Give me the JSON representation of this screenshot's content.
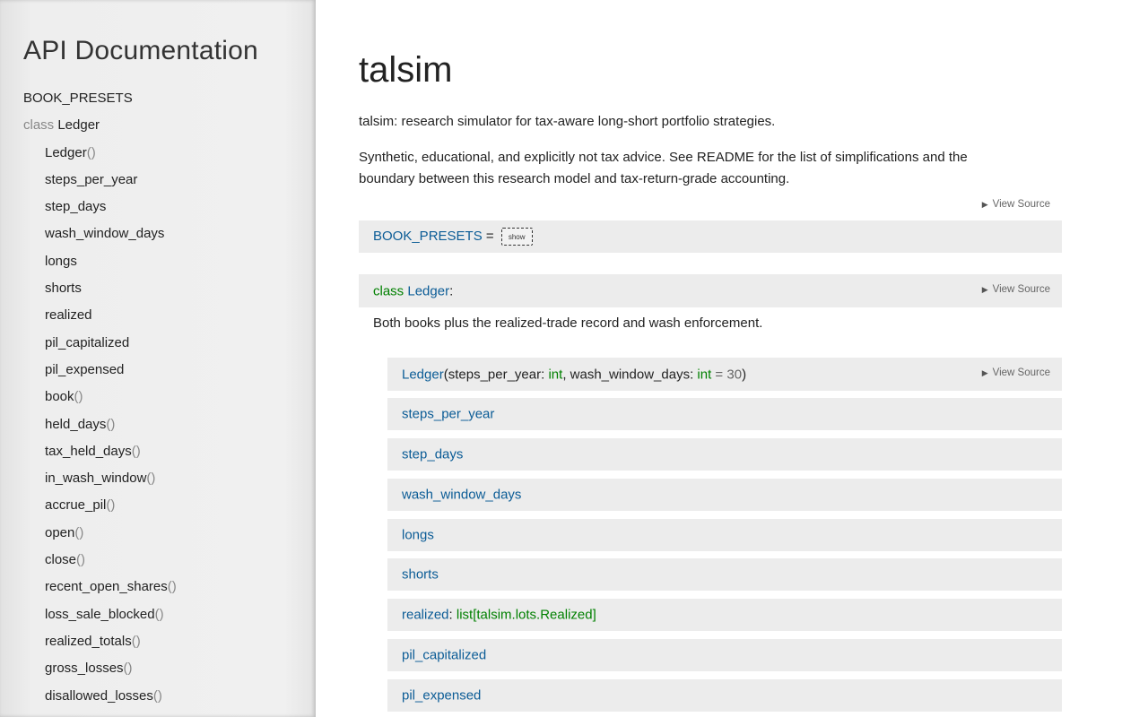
{
  "sidebar": {
    "title": "API Documentation",
    "items": [
      {
        "kw": "",
        "label": "BOOK_PRESETS",
        "paren": ""
      },
      {
        "kw": "class ",
        "label": "Ledger",
        "paren": ""
      },
      {
        "kw": "",
        "label": "Ledger",
        "paren": "()"
      },
      {
        "kw": "",
        "label": "steps_per_year",
        "paren": ""
      },
      {
        "kw": "",
        "label": "step_days",
        "paren": ""
      },
      {
        "kw": "",
        "label": "wash_window_days",
        "paren": ""
      },
      {
        "kw": "",
        "label": "longs",
        "paren": ""
      },
      {
        "kw": "",
        "label": "shorts",
        "paren": ""
      },
      {
        "kw": "",
        "label": "realized",
        "paren": ""
      },
      {
        "kw": "",
        "label": "pil_capitalized",
        "paren": ""
      },
      {
        "kw": "",
        "label": "pil_expensed",
        "paren": ""
      },
      {
        "kw": "",
        "label": "book",
        "paren": "()"
      },
      {
        "kw": "",
        "label": "held_days",
        "paren": "()"
      },
      {
        "kw": "",
        "label": "tax_held_days",
        "paren": "()"
      },
      {
        "kw": "",
        "label": "in_wash_window",
        "paren": "()"
      },
      {
        "kw": "",
        "label": "accrue_pil",
        "paren": "()"
      },
      {
        "kw": "",
        "label": "open",
        "paren": "()"
      },
      {
        "kw": "",
        "label": "close",
        "paren": "()"
      },
      {
        "kw": "",
        "label": "recent_open_shares",
        "paren": "()"
      },
      {
        "kw": "",
        "label": "loss_sale_blocked",
        "paren": "()"
      },
      {
        "kw": "",
        "label": "realized_totals",
        "paren": "()"
      },
      {
        "kw": "",
        "label": "gross_losses",
        "paren": "()"
      },
      {
        "kw": "",
        "label": "disallowed_losses",
        "paren": "()"
      }
    ]
  },
  "main": {
    "title": "talsim",
    "intro": "talsim: research simulator for tax-aware long-short portfolio strategies.",
    "description": "Synthetic, educational, and explicitly not tax advice. See README for the list of simplifications and the boundary between this research model and tax-return-grade accounting.",
    "view_source_label": "View Source",
    "book_presets": {
      "name": "BOOK_PRESETS",
      "eq": " = ",
      "show_label": "show"
    },
    "class_ledger": {
      "kw": "class",
      "name": "Ledger",
      "colon": ":",
      "description": "Both books plus the realized-trade record and wash enforcement."
    },
    "constructor": {
      "name": "Ledger",
      "open_paren": "(",
      "param1": "steps_per_year",
      "param1_sep": ": ",
      "param1_type": "int",
      "comma": ", ",
      "param2": "wash_window_days",
      "param2_sep": ": ",
      "param2_type": "int",
      "default_eq": " = ",
      "default_val": "30",
      "close_paren": ")"
    },
    "members": [
      {
        "name": "steps_per_year",
        "sep": "",
        "type": ""
      },
      {
        "name": "step_days",
        "sep": "",
        "type": ""
      },
      {
        "name": "wash_window_days",
        "sep": "",
        "type": ""
      },
      {
        "name": "longs",
        "sep": "",
        "type": ""
      },
      {
        "name": "shorts",
        "sep": "",
        "type": ""
      },
      {
        "name": "realized",
        "sep": ": ",
        "type": "list[talsim.lots.Realized]"
      },
      {
        "name": "pil_capitalized",
        "sep": "",
        "type": ""
      },
      {
        "name": "pil_expensed",
        "sep": "",
        "type": ""
      }
    ]
  }
}
